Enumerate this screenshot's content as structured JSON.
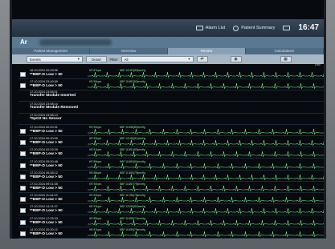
{
  "topbar": {
    "alarm_list": "Alarm List",
    "patient_summary": "Patient Summary",
    "time": "16:47"
  },
  "title": "Ar",
  "tabs": [
    "Patient Management",
    "Overview",
    "Review",
    "Calculations"
  ],
  "active_tab": "Review",
  "filter": {
    "events_select": "Events",
    "detail_button": "Detail",
    "filter_label": "Filter",
    "all_select": "All"
  },
  "strip_scale": "1mV",
  "rows": [
    {
      "ts": "16.10.2024  20:09:56",
      "event": "**BBP-D Low > 50",
      "strip": true,
      "hr": "HR 87bpm",
      "pvc": "NBP 127/67(89)mmHg"
    },
    {
      "ts": "17.10.2024  23:49:59",
      "event": "**BBP-D Low > 50",
      "strip": true,
      "hr": "HR 90bpm",
      "pvc": "NBP 115/62(82)mmHg"
    },
    {
      "ts": "17.10.2024  23:58:01",
      "event": "Transfer Module Inserted",
      "strip": false
    },
    {
      "ts": "17.10.2024  23:58:14",
      "event": "Transfer Module Removed",
      "strip": false
    },
    {
      "ts": "17.10.2024  23:58:14",
      "event": "*SpO2 No Sensor",
      "strip": false
    },
    {
      "ts": "17.10.2024  00:00:31",
      "event": "**BBP-D Low > 50",
      "strip": true,
      "hr": "HR 92bpm",
      "pvc": "NBP 114/58(80)mmHg"
    },
    {
      "ts": "17.10.2024  00:00:59",
      "event": "**BBP-D Low > 50",
      "strip": true,
      "hr": "HR 93bpm",
      "pvc": "NBP 121/60(81)mmHg"
    },
    {
      "ts": "17.10.2024  02:02:29",
      "event": "**BBP-D Low > 50",
      "strip": true,
      "hr": "HR 91bpm",
      "pvc": "NBP 119/61(83)mmHg"
    },
    {
      "ts": "17.10.2024  05:00:48",
      "event": "**BBP-D Low > 50",
      "strip": true,
      "hr": "HR 89bpm",
      "pvc": "NBP 116/60(81)mmHg"
    },
    {
      "ts": "17.10.2024  06:08:12",
      "event": "**BBP-D Low > 50",
      "strip": true,
      "hr": "HR 88bpm",
      "pvc": "NBP 113/59(79)mmHg"
    },
    {
      "ts": "17.10.2024  09:01:55",
      "event": "**BBP-D Low > 50",
      "strip": true,
      "hr": "HR 90bpm",
      "pvc": "NBP 118/57(79)mmHg"
    },
    {
      "ts": "17.10.2024  11:44:03",
      "event": "**BBP-D Low > 50",
      "strip": true,
      "hr": "HR 92bpm",
      "pvc": "NBP 117/58(78)mmHg"
    },
    {
      "ts": "17.10.2024  14:21:07",
      "event": "**BBP-D Low > 50",
      "strip": true,
      "hr": "HR 91bpm",
      "pvc": "NBP 120/60(80)mmHg"
    },
    {
      "ts": "17.10.2024  17:05:33",
      "event": "**BBP-D Low > 50",
      "strip": true,
      "hr": "HR 89bpm",
      "pvc": "NBP 115/58(77)mmHg"
    },
    {
      "ts": "14.10.2024  20:00:12",
      "event": "**BBP-D Low > 50",
      "strip": true,
      "hr": "HR 87bpm",
      "pvc": "NBP 119/59(79)mmHg"
    }
  ],
  "colors": {
    "trace": "#7cf08a",
    "header": "#5a7891",
    "background": "#070a0e"
  },
  "icons": [
    "alarm-list-icon",
    "patient-summary-icon",
    "printer-icon",
    "refresh-icon",
    "camera-icon",
    "grid-icon"
  ]
}
